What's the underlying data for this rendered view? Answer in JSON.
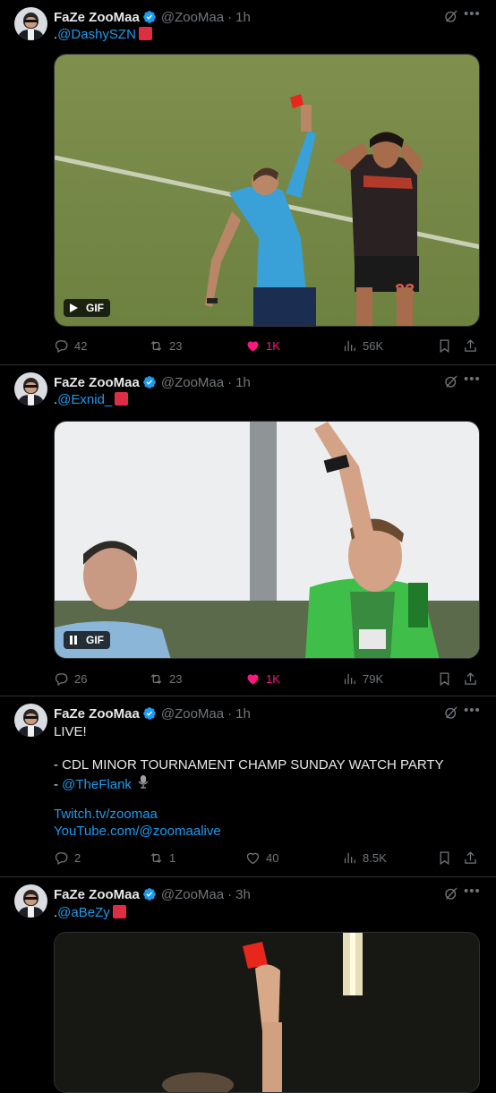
{
  "colors": {
    "background": "#000000",
    "text": "#e7e9ea",
    "muted": "#71767b",
    "link": "#1d9bf0",
    "like": "#f91880",
    "verified": "#1d9bf0",
    "red_square": "#dd2e44"
  },
  "tweets": [
    {
      "name": "FaZe ZooMaa",
      "handle": "@ZooMaa",
      "sep": "·",
      "time": "1h",
      "reply_prefix": ".",
      "mention": "@DashySZN",
      "badge": "GIF",
      "stats": {
        "replies": "42",
        "reposts": "23",
        "likes": "1K",
        "views": "56K"
      },
      "liked": true
    },
    {
      "name": "FaZe ZooMaa",
      "handle": "@ZooMaa",
      "sep": "·",
      "time": "1h",
      "reply_prefix": ".",
      "mention": "@Exnid_",
      "badge": "GIF",
      "stats": {
        "replies": "26",
        "reposts": "23",
        "likes": "1K",
        "views": "79K"
      },
      "liked": true
    },
    {
      "name": "FaZe ZooMaa",
      "handle": "@ZooMaa",
      "sep": "·",
      "time": "1h",
      "lines": {
        "l1": "LIVE!",
        "l2": "- CDL MINOR TOURNAMENT CHAMP SUNDAY WATCH PARTY",
        "l3_prefix": "- ",
        "l3_mention": "@TheFlank",
        "l4": "Twitch.tv/zoomaa",
        "l5": "YouTube.com/@zoomaalive"
      },
      "stats": {
        "replies": "2",
        "reposts": "1",
        "likes": "40",
        "views": "8.5K"
      },
      "liked": false
    },
    {
      "name": "FaZe ZooMaa",
      "handle": "@ZooMaa",
      "sep": "·",
      "time": "3h",
      "reply_prefix": ".",
      "mention": "@aBeZy"
    }
  ],
  "icons": [
    "avatar",
    "verified-icon",
    "grok-icon",
    "more-icon",
    "reply-icon",
    "repost-icon",
    "like-icon",
    "views-icon",
    "bookmark-icon",
    "share-icon",
    "play-icon",
    "pause-icon",
    "mic-icon"
  ]
}
